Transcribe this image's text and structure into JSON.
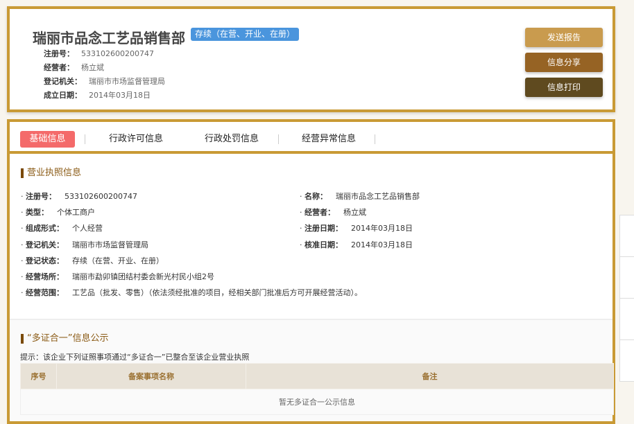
{
  "header": {
    "name": "瑞丽市品念工艺品销售部",
    "status": "存续（在营、开业、在册）",
    "rows": [
      {
        "label": "注册号：",
        "value": "533102600200747"
      },
      {
        "label": "经营者：",
        "value": "杨立斌"
      },
      {
        "label": "登记机关：",
        "value": "瑞丽市市场监督管理局"
      },
      {
        "label": "成立日期：",
        "value": "2014年03月18日"
      }
    ],
    "buttons": {
      "send": "发送报告",
      "share": "信息分享",
      "print": "信息打印"
    },
    "colors": {
      "send": "#c99b4e",
      "share": "#966324",
      "print": "#5f4a1f"
    }
  },
  "tabs": [
    "基础信息",
    "行政许可信息",
    "行政处罚信息",
    "经营异常信息"
  ],
  "license": {
    "title": "营业执照信息",
    "left": [
      {
        "label": "注册号：",
        "value": "533102600200747"
      },
      {
        "label": "类型：",
        "value": "个体工商户"
      },
      {
        "label": "组成形式：",
        "value": "个人经营"
      },
      {
        "label": "登记机关：",
        "value": "瑞丽市市场监督管理局"
      },
      {
        "label": "登记状态：",
        "value": "存续（在营、开业、在册）"
      },
      {
        "label": "经营场所：",
        "value": "瑞丽市勐卯镇团结村委会新光村民小组2号"
      },
      {
        "label": "经营范围：",
        "value": "工艺品（批发、零售）（依法须经批准的项目，经相关部门批准后方可开展经营活动）。"
      }
    ],
    "right": [
      {
        "label": "名称：",
        "value": "瑞丽市品念工艺品销售部"
      },
      {
        "label": "经营者：",
        "value": "杨立斌"
      },
      {
        "label": "注册日期：",
        "value": "2014年03月18日"
      },
      {
        "label": "核准日期：",
        "value": "2014年03月18日"
      }
    ]
  },
  "multi": {
    "title": "“多证合一”信息公示",
    "hint": "提示：该企业下列证照事项通过“多证合一”已整合至该企业营业执照",
    "columns": [
      "序号",
      "备案事项名称",
      "备注"
    ],
    "empty": "暂无多证合一公示信息"
  }
}
